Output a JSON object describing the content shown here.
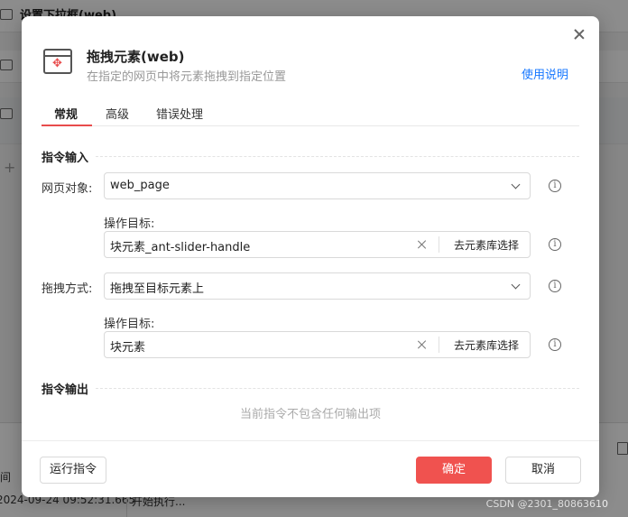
{
  "background": {
    "header_title": "设置下拉框(web)",
    "log_column_header": "间",
    "log_time": "2024-09-24 09:52:31.665",
    "log_message": "开始执行...",
    "watermark": "CSDN @2301_80863610"
  },
  "dialog": {
    "title": "拖拽元素(web)",
    "subtitle": "在指定的网页中将元素拖拽到指定位置",
    "help_link": "使用说明",
    "tabs": [
      {
        "label": "常规",
        "active": true
      },
      {
        "label": "高级",
        "active": false
      },
      {
        "label": "错误处理",
        "active": false
      }
    ],
    "input_section": "指令输入",
    "web_object": {
      "label": "网页对象:",
      "value": "web_page"
    },
    "target1": {
      "label": "操作目标:",
      "value": "块元素_ant-slider-handle",
      "library_button": "去元素库选择"
    },
    "drag_mode": {
      "label": "拖拽方式:",
      "value": "拖拽至目标元素上"
    },
    "target2": {
      "label": "操作目标:",
      "value": "块元素",
      "library_button": "去元素库选择"
    },
    "output_section": "指令输出",
    "empty_output": "当前指令不包含任何输出项",
    "buttons": {
      "run": "运行指令",
      "ok": "确定",
      "cancel": "取消"
    }
  },
  "colors": {
    "accent": "#f0524f",
    "link": "#1677ff"
  }
}
